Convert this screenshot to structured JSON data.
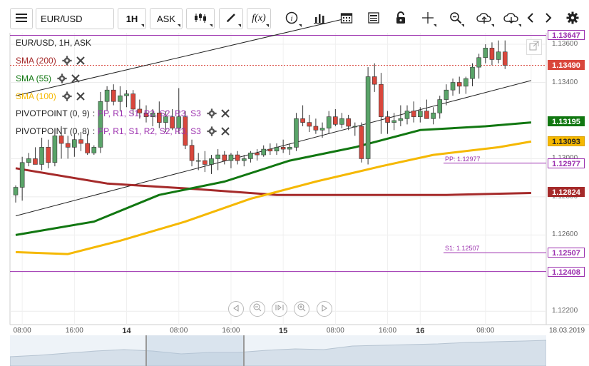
{
  "toolbar": {
    "symbol": "EUR/USD",
    "interval": "1H",
    "price_type": "ASK",
    "icons": [
      "menu-icon",
      "candlestick-type-icon",
      "draw-pencil-icon",
      "function-icon",
      "info-icon",
      "bar-chart-icon",
      "calendar-icon",
      "news-icon",
      "lock-icon",
      "crosshair-icon",
      "zoom-icon",
      "cloud-upload-icon",
      "cloud-download-icon",
      "chevron-left-icon",
      "chevron-right-icon",
      "gear-icon"
    ]
  },
  "header": {
    "title": "EUR/USD, 1H, ASK"
  },
  "legend": {
    "sma200": "SMA (200)",
    "sma55": "SMA (55)",
    "sma100": "SMA (100)",
    "pivot1_name": "PIVOTPOINT (0, 9)",
    "pivot2_name": "PIVOTPOINT (0, 8)",
    "pivot_sep": ":",
    "pivot_levels": [
      "PP,",
      "R1,",
      "S1,",
      "R2,",
      "S2,",
      "R3,",
      "S3"
    ]
  },
  "colors": {
    "sma200": "#a52a2a",
    "sma55": "#117711",
    "sma100": "#f5b800",
    "pivot": "#9b2fae",
    "up": "#5aa469",
    "down": "#d9473c",
    "price_tag": "#d9473c"
  },
  "price_tags": [
    {
      "label": "1.13647",
      "value": 1.13647,
      "style": "pivot"
    },
    {
      "label": "1.13490",
      "value": 1.1349,
      "style": "price"
    },
    {
      "label": "1.13195",
      "value": 1.13195,
      "style": "sma55"
    },
    {
      "label": "1.13093",
      "value": 1.13093,
      "style": "sma100"
    },
    {
      "label": "1.12977",
      "value": 1.12977,
      "style": "pivot-line"
    },
    {
      "label": "1.12824",
      "value": 1.12824,
      "style": "sma200"
    },
    {
      "label": "1.12507",
      "value": 1.12507,
      "style": "pivot-line"
    },
    {
      "label": "1.12408",
      "value": 1.12408,
      "style": "pivot-line"
    }
  ],
  "pivot_labels": [
    {
      "label": "PP: 1.12977",
      "value": 1.12977
    },
    {
      "label": "S1: 1.12507",
      "value": 1.12507
    }
  ],
  "chart_data": {
    "type": "candlestick",
    "title": "EUR/USD, 1H, ASK",
    "y_ticks": [
      {
        "label": "1.13600",
        "value": 1.136
      },
      {
        "label": "1.13400",
        "value": 1.134
      },
      {
        "label": "1.13000",
        "value": 1.13
      },
      {
        "label": "1.12800",
        "value": 1.128
      },
      {
        "label": "1.12600",
        "value": 1.126
      },
      {
        "label": "1.12200",
        "value": 1.122
      }
    ],
    "ylim": [
      1.1213,
      1.1366
    ],
    "x_ticks": [
      {
        "label": "08:00",
        "idx": 1,
        "bold": false
      },
      {
        "label": "16:00",
        "idx": 9,
        "bold": false
      },
      {
        "label": "14",
        "idx": 17,
        "bold": true
      },
      {
        "label": "08:00",
        "idx": 25,
        "bold": false
      },
      {
        "label": "16:00",
        "idx": 33,
        "bold": false
      },
      {
        "label": "15",
        "idx": 41,
        "bold": true
      },
      {
        "label": "08:00",
        "idx": 49,
        "bold": false
      },
      {
        "label": "16:00",
        "idx": 57,
        "bold": false
      },
      {
        "label": "16",
        "idx": 62,
        "bold": true
      },
      {
        "label": "08:00",
        "idx": 72,
        "bold": false
      },
      {
        "label": "18.03.2019",
        "idx": 79,
        "bold": false
      }
    ],
    "candles": [
      [
        1.1281,
        1.1286,
        1.1277,
        1.1285
      ],
      [
        1.1285,
        1.1301,
        1.1278,
        1.1298
      ],
      [
        1.1298,
        1.1303,
        1.1296,
        1.13
      ],
      [
        1.13,
        1.1306,
        1.1297,
        1.1297
      ],
      [
        1.1297,
        1.1311,
        1.1294,
        1.1306
      ],
      [
        1.1306,
        1.131,
        1.1295,
        1.1298
      ],
      [
        1.1298,
        1.1316,
        1.1296,
        1.1312
      ],
      [
        1.1312,
        1.1317,
        1.13,
        1.1308
      ],
      [
        1.1308,
        1.1312,
        1.13,
        1.1306
      ],
      [
        1.1306,
        1.1313,
        1.1301,
        1.131
      ],
      [
        1.131,
        1.1314,
        1.1304,
        1.1308
      ],
      [
        1.1308,
        1.1313,
        1.1302,
        1.1303
      ],
      [
        1.1303,
        1.1307,
        1.1302,
        1.1306
      ],
      [
        1.1306,
        1.1335,
        1.1303,
        1.133
      ],
      [
        1.133,
        1.1338,
        1.1325,
        1.1336
      ],
      [
        1.1336,
        1.1339,
        1.1328,
        1.133
      ],
      [
        1.133,
        1.1338,
        1.1325,
        1.1333
      ],
      [
        1.1333,
        1.1336,
        1.1327,
        1.1334
      ],
      [
        1.1334,
        1.1336,
        1.1323,
        1.1326
      ],
      [
        1.1326,
        1.1331,
        1.1321,
        1.1324
      ],
      [
        1.1324,
        1.1328,
        1.1319,
        1.1322
      ],
      [
        1.1322,
        1.1326,
        1.1317,
        1.1324
      ],
      [
        1.1324,
        1.133,
        1.1316,
        1.1319
      ],
      [
        1.1319,
        1.1325,
        1.1314,
        1.1322
      ],
      [
        1.1322,
        1.1326,
        1.1315,
        1.1316
      ],
      [
        1.1316,
        1.1337,
        1.1313,
        1.1322
      ],
      [
        1.1322,
        1.1325,
        1.1305,
        1.1307
      ],
      [
        1.1307,
        1.131,
        1.1296,
        1.1299
      ],
      [
        1.1299,
        1.1303,
        1.1294,
        1.1299
      ],
      [
        1.1299,
        1.1304,
        1.1293,
        1.1297
      ],
      [
        1.1297,
        1.1302,
        1.1292,
        1.13
      ],
      [
        1.13,
        1.1305,
        1.1294,
        1.1302
      ],
      [
        1.1302,
        1.1304,
        1.1297,
        1.1299
      ],
      [
        1.1299,
        1.1303,
        1.1295,
        1.1302
      ],
      [
        1.1302,
        1.1304,
        1.1297,
        1.1299
      ],
      [
        1.1299,
        1.1302,
        1.1296,
        1.13
      ],
      [
        1.13,
        1.1304,
        1.1298,
        1.1303
      ],
      [
        1.1303,
        1.1305,
        1.1299,
        1.1302
      ],
      [
        1.1302,
        1.1307,
        1.1301,
        1.1305
      ],
      [
        1.1305,
        1.1308,
        1.1302,
        1.1304
      ],
      [
        1.1304,
        1.1308,
        1.1302,
        1.1306
      ],
      [
        1.1306,
        1.131,
        1.1303,
        1.1305
      ],
      [
        1.1305,
        1.1308,
        1.1302,
        1.1306
      ],
      [
        1.1306,
        1.1324,
        1.1304,
        1.1321
      ],
      [
        1.1321,
        1.1328,
        1.1317,
        1.1319
      ],
      [
        1.1319,
        1.1323,
        1.1314,
        1.1317
      ],
      [
        1.1317,
        1.1321,
        1.1313,
        1.1315
      ],
      [
        1.1315,
        1.1319,
        1.1311,
        1.1316
      ],
      [
        1.1316,
        1.1325,
        1.1313,
        1.1322
      ],
      [
        1.1322,
        1.1326,
        1.1317,
        1.1318
      ],
      [
        1.1318,
        1.1324,
        1.1316,
        1.1321
      ],
      [
        1.1321,
        1.1323,
        1.1315,
        1.1317
      ],
      [
        1.1317,
        1.1319,
        1.1312,
        1.1317
      ],
      [
        1.1317,
        1.1319,
        1.1298,
        1.13
      ],
      [
        1.13,
        1.1348,
        1.1297,
        1.1343
      ],
      [
        1.1343,
        1.135,
        1.1335,
        1.1339
      ],
      [
        1.1339,
        1.1345,
        1.1313,
        1.1322
      ],
      [
        1.1322,
        1.1325,
        1.1313,
        1.1319
      ],
      [
        1.1319,
        1.1324,
        1.1315,
        1.132
      ],
      [
        1.132,
        1.1328,
        1.1317,
        1.1321
      ],
      [
        1.1321,
        1.1328,
        1.1318,
        1.1325
      ],
      [
        1.1325,
        1.133,
        1.1319,
        1.1322
      ],
      [
        1.1322,
        1.1327,
        1.1319,
        1.1325
      ],
      [
        1.1325,
        1.1331,
        1.1321,
        1.1321
      ],
      [
        1.1321,
        1.1327,
        1.1318,
        1.1324
      ],
      [
        1.1324,
        1.1333,
        1.1321,
        1.1331
      ],
      [
        1.1331,
        1.1339,
        1.1328,
        1.1336
      ],
      [
        1.1336,
        1.1342,
        1.1333,
        1.134
      ],
      [
        1.134,
        1.1343,
        1.1334,
        1.1338
      ],
      [
        1.1338,
        1.1343,
        1.1334,
        1.1342
      ],
      [
        1.1342,
        1.135,
        1.1338,
        1.1348
      ],
      [
        1.1348,
        1.1355,
        1.1342,
        1.1353
      ],
      [
        1.1353,
        1.136,
        1.135,
        1.1358
      ],
      [
        1.1358,
        1.1361,
        1.1349,
        1.1352
      ],
      [
        1.1352,
        1.1362,
        1.135,
        1.1356
      ],
      [
        1.1356,
        1.1362,
        1.1347,
        1.1349
      ]
    ],
    "sma55": [
      [
        0,
        1.126
      ],
      [
        12,
        1.1267
      ],
      [
        22,
        1.1281
      ],
      [
        32,
        1.1288
      ],
      [
        42,
        1.1299
      ],
      [
        52,
        1.1306
      ],
      [
        62,
        1.1315
      ],
      [
        72,
        1.1317
      ],
      [
        79,
        1.1319
      ]
    ],
    "sma100": [
      [
        0,
        1.1251
      ],
      [
        8,
        1.125
      ],
      [
        16,
        1.1257
      ],
      [
        26,
        1.1267
      ],
      [
        36,
        1.1279
      ],
      [
        46,
        1.1288
      ],
      [
        56,
        1.1296
      ],
      [
        64,
        1.1302
      ],
      [
        74,
        1.1306
      ],
      [
        79,
        1.1309
      ]
    ],
    "sma200": [
      [
        0,
        1.1295
      ],
      [
        14,
        1.1287
      ],
      [
        28,
        1.1284
      ],
      [
        40,
        1.1281
      ],
      [
        52,
        1.1281
      ],
      [
        66,
        1.1281
      ],
      [
        79,
        1.1282
      ]
    ],
    "trendlines": [
      {
        "p1": [
          0,
          1.127
        ],
        "p2": [
          79,
          1.1341
        ]
      },
      {
        "p1": [
          0,
          1.1333
        ],
        "p2": [
          50,
          1.1373
        ]
      }
    ]
  },
  "overview": {
    "band_left": "8%",
    "band_right": "40%"
  }
}
